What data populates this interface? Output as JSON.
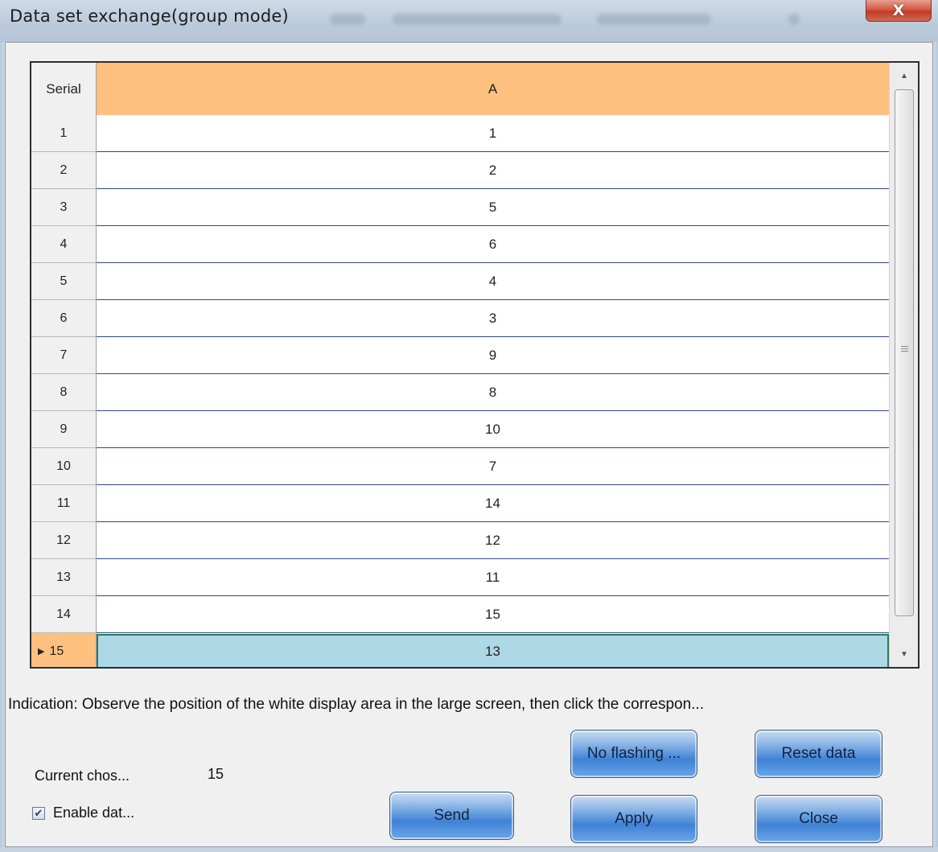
{
  "window": {
    "title": "Data set exchange(group mode)",
    "close_glyph": "X"
  },
  "grid": {
    "columns": [
      "Serial",
      "A"
    ],
    "rows": [
      {
        "serial": "1",
        "value": "1"
      },
      {
        "serial": "2",
        "value": "2"
      },
      {
        "serial": "3",
        "value": "5"
      },
      {
        "serial": "4",
        "value": "6"
      },
      {
        "serial": "5",
        "value": "4"
      },
      {
        "serial": "6",
        "value": "3"
      },
      {
        "serial": "7",
        "value": "9"
      },
      {
        "serial": "8",
        "value": "8"
      },
      {
        "serial": "9",
        "value": "10"
      },
      {
        "serial": "10",
        "value": "7"
      },
      {
        "serial": "11",
        "value": "14"
      },
      {
        "serial": "12",
        "value": "12"
      },
      {
        "serial": "13",
        "value": "11"
      },
      {
        "serial": "14",
        "value": "15"
      },
      {
        "serial": "15",
        "value": "13"
      }
    ],
    "selected_serial": "15"
  },
  "indication": "Indication: Observe the position of the white display area in the large screen, then click the correspon...",
  "current": {
    "label": "Current chos...",
    "value": "15"
  },
  "enable": {
    "label": "Enable dat...",
    "checked": true
  },
  "buttons": {
    "no_flashing": "No flashing ...",
    "reset": "Reset data",
    "send": "Send",
    "apply": "Apply",
    "close": "Close"
  },
  "colors": {
    "header_accent": "#fdc07f",
    "selected_row": "#add8e5",
    "button_blue": "#3f82d6"
  }
}
